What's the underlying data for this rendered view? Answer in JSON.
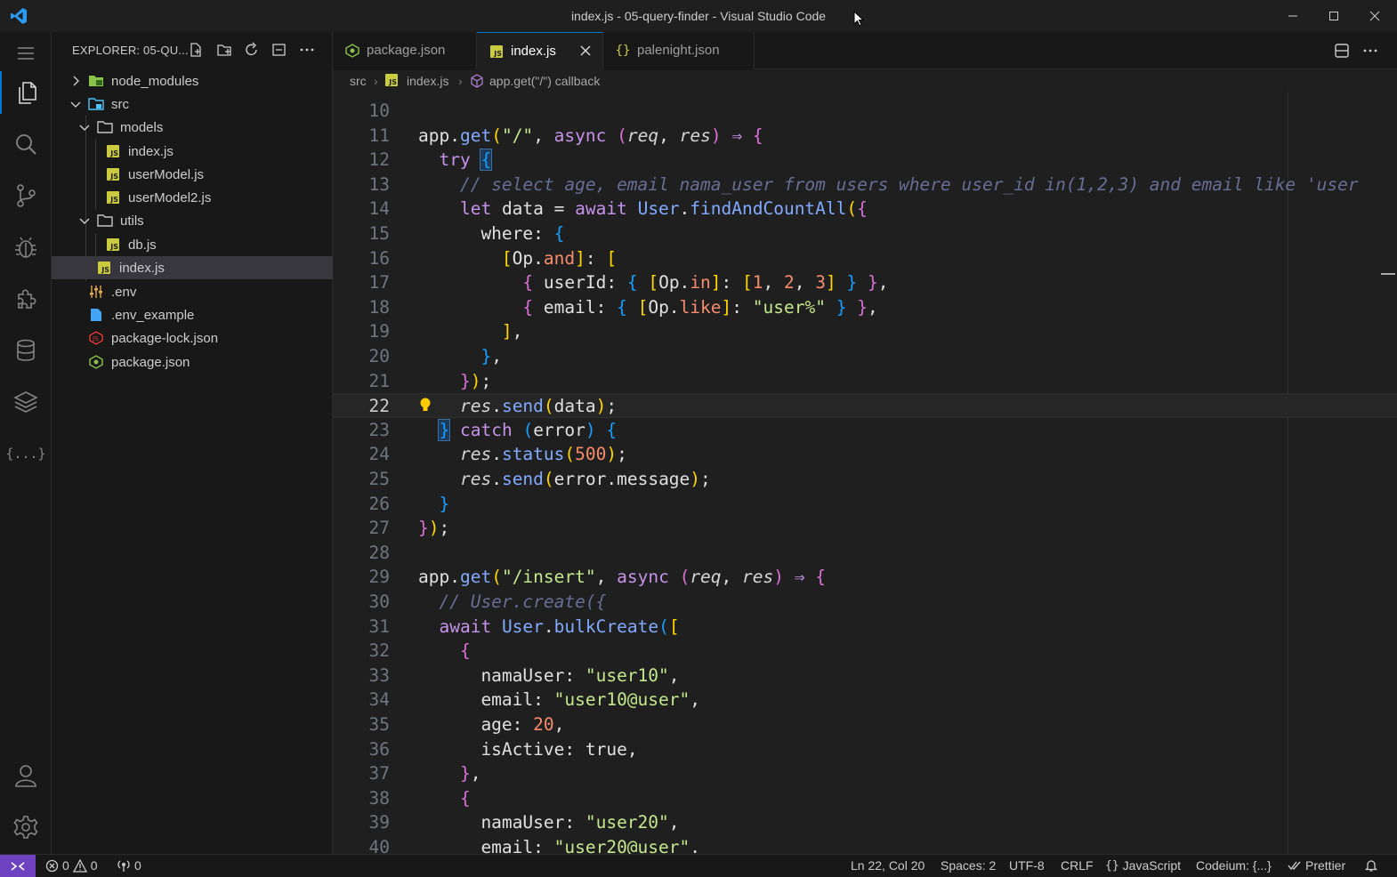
{
  "window": {
    "title": "index.js - 05-query-finder - Visual Studio Code"
  },
  "sidebar": {
    "header_label": "EXPLORER: 05-QU...",
    "tree": [
      {
        "name": "node_modules"
      },
      {
        "name": "src"
      },
      {
        "name": "models"
      },
      {
        "name": "index.js"
      },
      {
        "name": "userModel.js"
      },
      {
        "name": "userModel2.js"
      },
      {
        "name": "utils"
      },
      {
        "name": "db.js"
      },
      {
        "name": "index.js"
      },
      {
        "name": ".env"
      },
      {
        "name": ".env_example"
      },
      {
        "name": "package-lock.json"
      },
      {
        "name": "package.json"
      }
    ]
  },
  "tabs": [
    {
      "label": "package.json"
    },
    {
      "label": "index.js"
    },
    {
      "label": "palenight.json"
    }
  ],
  "breadcrumb": {
    "folder": "src",
    "file": "index.js",
    "symbol": "app.get(\"/\") callback"
  },
  "editor": {
    "line_numbers": [
      "10",
      "11",
      "12",
      "13",
      "14",
      "15",
      "16",
      "17",
      "18",
      "19",
      "20",
      "21",
      "22",
      "23",
      "24",
      "25",
      "26",
      "27",
      "28",
      "29",
      "30",
      "31",
      "32",
      "33",
      "34",
      "35",
      "36",
      "37",
      "38",
      "39",
      "40"
    ],
    "current_line": "22"
  },
  "status": {
    "errors": "0",
    "warnings": "0",
    "ports": "0",
    "position": "Ln 22, Col 20",
    "spaces": "Spaces: 2",
    "encoding": "UTF-8",
    "eol": "CRLF",
    "language": "JavaScript",
    "codeium": "Codeium: {...}",
    "prettier": "Prettier"
  },
  "colors": {
    "accent": "#0078d4",
    "remote": "#6f42c1",
    "keyword": "#c792ea",
    "function": "#82aaff",
    "string": "#c3e88d",
    "number": "#f78c6c"
  }
}
